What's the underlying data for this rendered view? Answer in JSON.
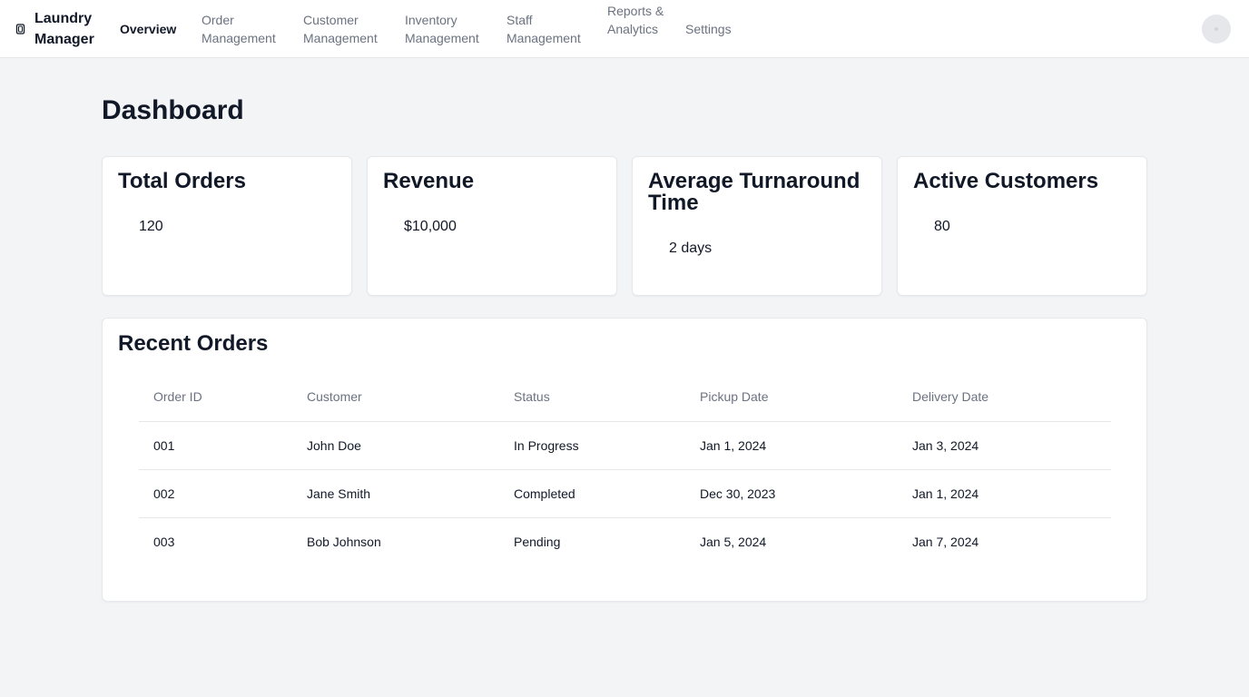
{
  "app": {
    "brand_icon": "laundry-basket-icon",
    "brand_name": "Laundry Manager"
  },
  "nav": {
    "items": [
      {
        "label": "Overview",
        "active": true
      },
      {
        "label": "Order Management",
        "active": false
      },
      {
        "label": "Customer Management",
        "active": false
      },
      {
        "label": "Inventory Management",
        "active": false
      },
      {
        "label": "Staff Management",
        "active": false
      },
      {
        "label": "Reports & Analytics",
        "active": false
      },
      {
        "label": "Settings",
        "active": false
      }
    ],
    "avatar_icon": "user-avatar-icon"
  },
  "page": {
    "title": "Dashboard"
  },
  "stats": [
    {
      "title": "Total Orders",
      "value": "120"
    },
    {
      "title": "Revenue",
      "value": "$10,000"
    },
    {
      "title": "Average Turnaround Time",
      "value": "2 days"
    },
    {
      "title": "Active Customers",
      "value": "80"
    }
  ],
  "recent_orders": {
    "title": "Recent Orders",
    "columns": [
      "Order ID",
      "Customer",
      "Status",
      "Pickup Date",
      "Delivery Date"
    ],
    "rows": [
      [
        "001",
        "John Doe",
        "In Progress",
        "Jan 1, 2024",
        "Jan 3, 2024"
      ],
      [
        "002",
        "Jane Smith",
        "Completed",
        "Dec 30, 2023",
        "Jan 1, 2024"
      ],
      [
        "003",
        "Bob Johnson",
        "Pending",
        "Jan 5, 2024",
        "Jan 7, 2024"
      ]
    ]
  },
  "colors": {
    "background": "#f3f4f6",
    "surface": "#ffffff",
    "text_primary": "#111827",
    "text_muted": "#6b7280",
    "border": "#e5e7eb"
  }
}
